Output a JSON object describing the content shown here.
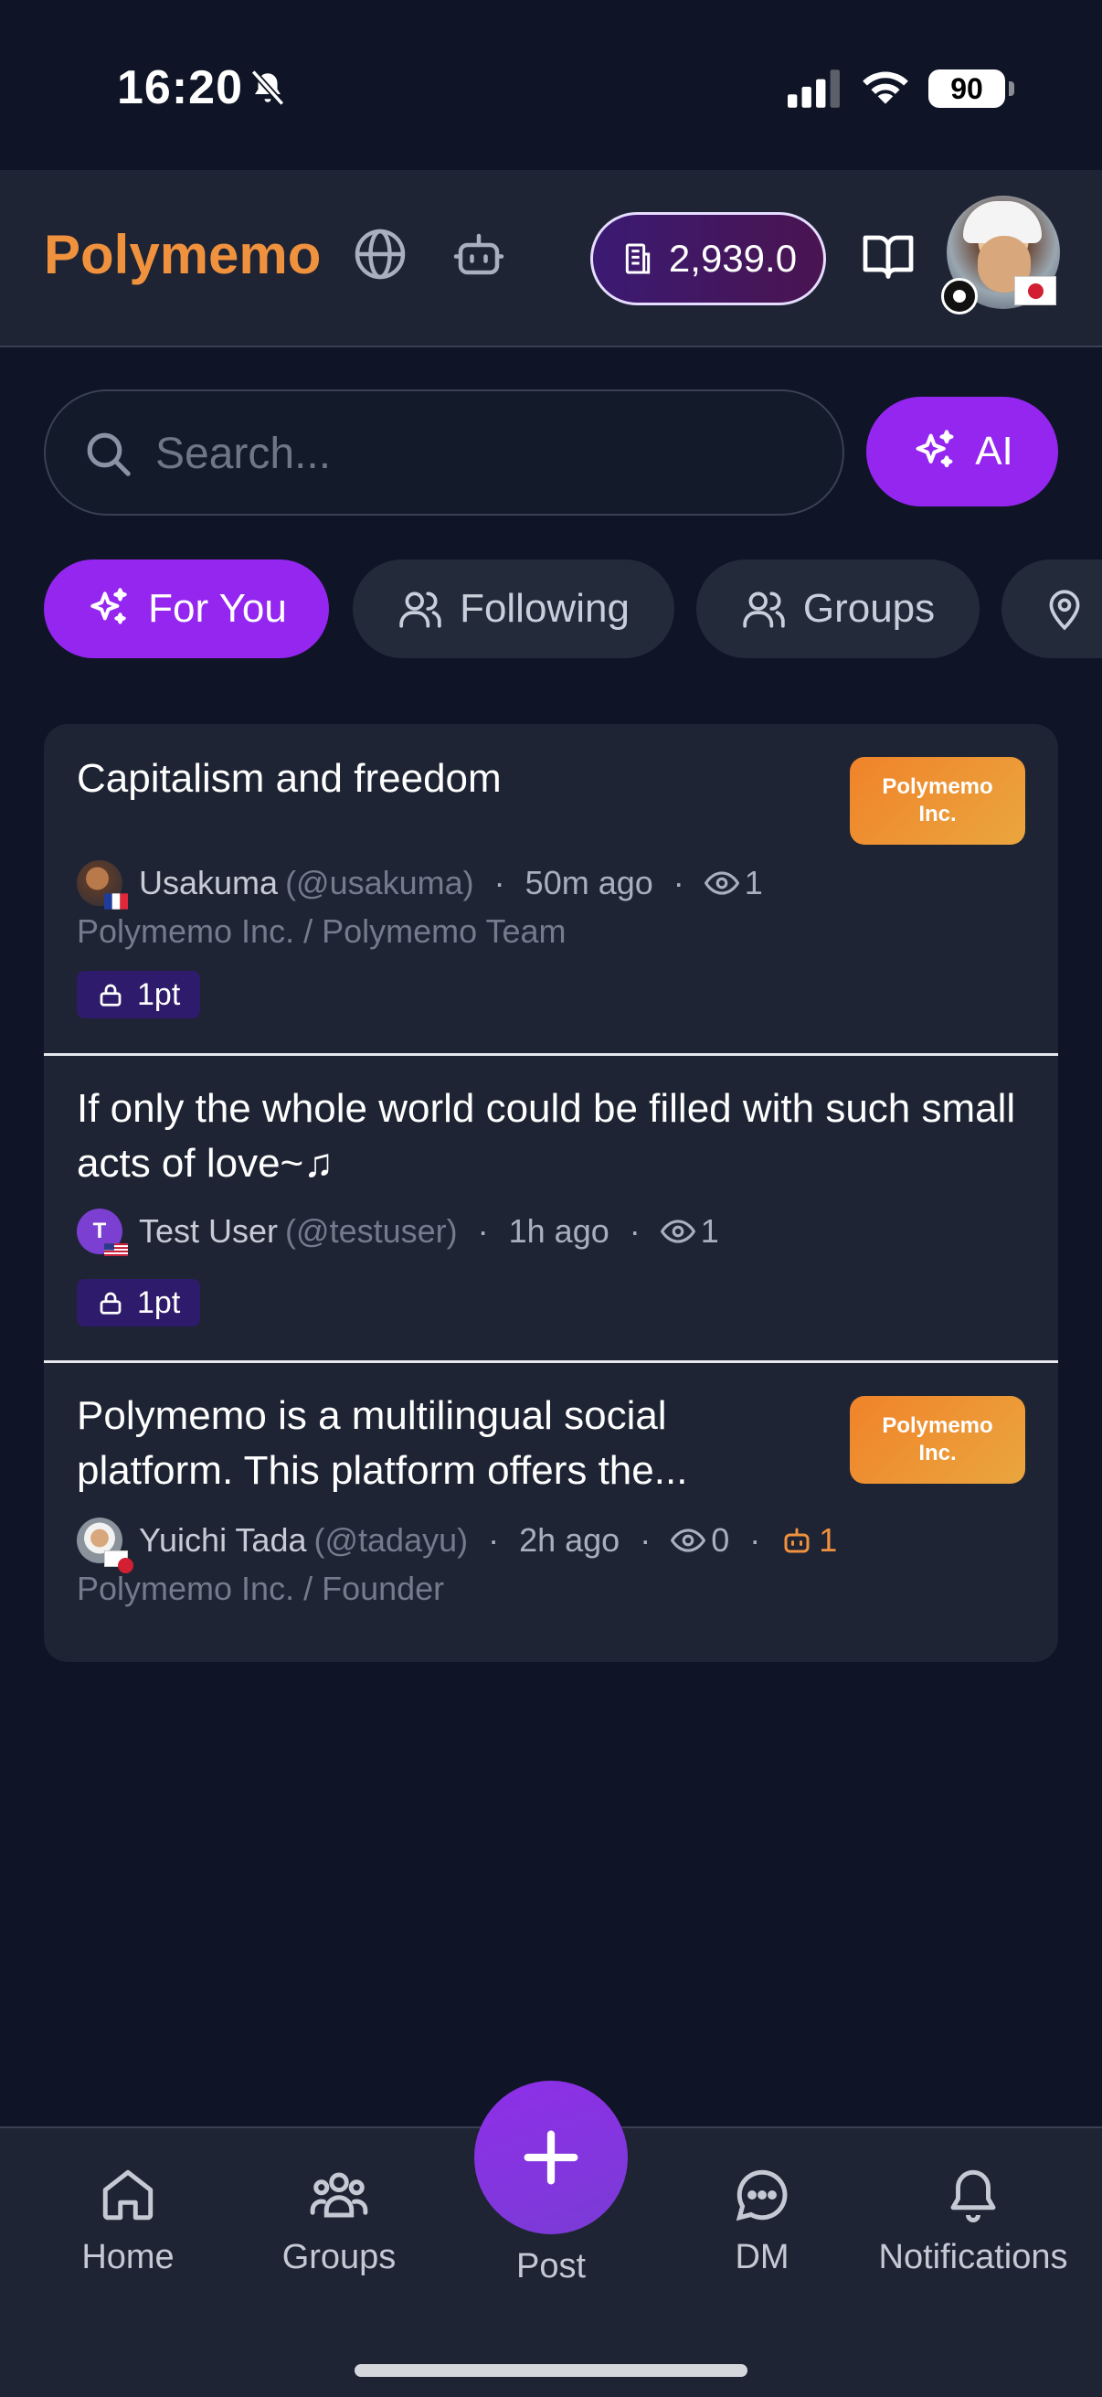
{
  "status_bar": {
    "time": "16:20",
    "battery": "90"
  },
  "header": {
    "brand": "Polymemo",
    "points": "2,939.0"
  },
  "search": {
    "placeholder": "Search...",
    "value": ""
  },
  "ai_button": {
    "label": "AI"
  },
  "tabs": [
    {
      "label": "For You",
      "active": true
    },
    {
      "label": "Following",
      "active": false
    },
    {
      "label": "Groups",
      "active": false
    }
  ],
  "posts": [
    {
      "title": "Capitalism and freedom",
      "org_badge": "Polymemo Inc.",
      "author": "Usakuma",
      "handle": "(@usakuma)",
      "time": "50m ago",
      "views": "1",
      "org_line": "Polymemo Inc. / Polymemo Team",
      "lock": "1pt"
    },
    {
      "title": "If only the whole world could be filled with such small acts of love~♫",
      "author": "Test User",
      "handle": "(@testuser)",
      "avatar_initial": "T",
      "time": "1h ago",
      "views": "1",
      "lock": "1pt"
    },
    {
      "title": "Polymemo is a multilingual social platform. This platform offers the...",
      "org_badge": "Polymemo Inc.",
      "author": "Yuichi Tada",
      "handle": "(@tadayu)",
      "time": "2h ago",
      "views": "0",
      "ai_count": "1",
      "org_line": "Polymemo Inc. / Founder"
    }
  ],
  "bottom_nav": {
    "home": "Home",
    "groups": "Groups",
    "post": "Post",
    "dm": "DM",
    "notifications": "Notifications"
  },
  "colors": {
    "brand": "#f0913e",
    "accent": "#9426f0",
    "background": "#0f1526",
    "card": "#1e2433"
  }
}
